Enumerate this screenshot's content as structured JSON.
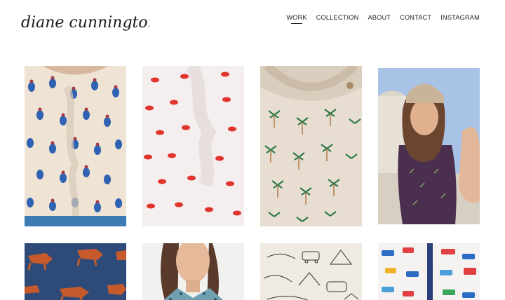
{
  "brand": {
    "logo_text": "diane cunnington"
  },
  "nav": {
    "items": [
      {
        "label": "WORK",
        "active": true
      },
      {
        "label": "COLLECTION",
        "active": false
      },
      {
        "label": "ABOUT",
        "active": false
      },
      {
        "label": "CONTACT",
        "active": false
      },
      {
        "label": "INSTAGRAM",
        "active": false
      }
    ]
  },
  "gallery": {
    "tiles": [
      {
        "subject": "blouse with pineapple print"
      },
      {
        "subject": "white dress with red lips print"
      },
      {
        "subject": "sweatshirt with palm tree print"
      },
      {
        "subject": "girl in beanie wearing purple dinosaur print"
      },
      {
        "subject": "fox pattern on navy"
      },
      {
        "subject": "woman in printed collar shirt"
      },
      {
        "subject": "line drawing travel pattern"
      },
      {
        "subject": "cars and buses pattern"
      }
    ]
  },
  "colors": {
    "accent": "#222222",
    "background": "#ffffff"
  }
}
